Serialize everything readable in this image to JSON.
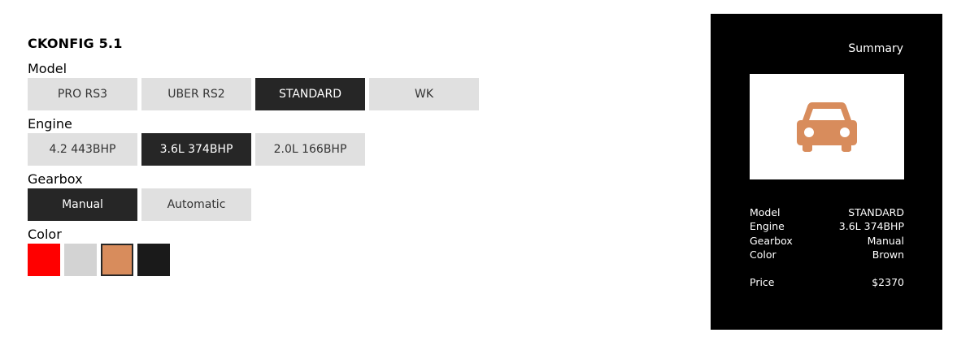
{
  "app": {
    "title": "CKONFIG 5.1"
  },
  "groups": {
    "model": {
      "label": "Model",
      "options": [
        "PRO RS3",
        "UBER RS2",
        "STANDARD",
        "WK"
      ],
      "selected": "STANDARD"
    },
    "engine": {
      "label": "Engine",
      "options": [
        "4.2 443BHP",
        "3.6L 374BHP",
        "2.0L 166BHP"
      ],
      "selected": "3.6L 374BHP"
    },
    "gearbox": {
      "label": "Gearbox",
      "options": [
        "Manual",
        "Automatic"
      ],
      "selected": "Manual"
    },
    "color": {
      "label": "Color",
      "swatches": [
        {
          "name": "Red",
          "hex": "#ff0000"
        },
        {
          "name": "Silver",
          "hex": "#d3d3d3"
        },
        {
          "name": "Brown",
          "hex": "#d88c5c"
        },
        {
          "name": "Black",
          "hex": "#1a1a1a"
        }
      ],
      "selected": "Brown"
    }
  },
  "summary": {
    "title": "Summary",
    "car_icon": "car-icon",
    "car_color": "#d88c5c",
    "rows": [
      {
        "label": "Model",
        "value": "STANDARD"
      },
      {
        "label": "Engine",
        "value": "3.6L 374BHP"
      },
      {
        "label": "Gearbox",
        "value": "Manual"
      },
      {
        "label": "Color",
        "value": "Brown"
      }
    ],
    "price": {
      "label": "Price",
      "value": "$2370"
    }
  },
  "colors": {
    "selected_bg": "#262626",
    "option_bg": "#e0e0e0",
    "panel_bg": "#000000"
  }
}
